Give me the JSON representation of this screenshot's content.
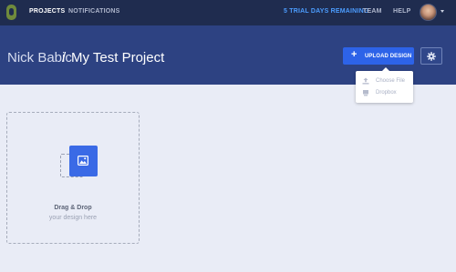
{
  "nav": {
    "projects": "PROJECTS",
    "notifications": "NOTIFICATIONS",
    "trial": "5 TRIAL DAYS REMAINING",
    "team": "TEAM",
    "help": "HELP"
  },
  "icons": {
    "logo": "app-logo",
    "avatar": "user-avatar",
    "caret": "chevron-down-icon",
    "upload_plus": "plus-icon",
    "settings": "gear-icon",
    "choose_file": "upload-icon",
    "dropbox": "dropbox-icon",
    "drop_tile": "image-icon"
  },
  "header": {
    "owner": "Nick Babic",
    "separator": "/",
    "project": "My Test Project"
  },
  "toolbar": {
    "upload_label": "UPLOAD DESIGN",
    "upload_plus": "+"
  },
  "upload_menu": {
    "items": [
      {
        "label": "Choose File"
      },
      {
        "label": "Dropbox"
      }
    ]
  },
  "dropzone": {
    "title": "Drag & Drop",
    "subtitle": "your design here"
  },
  "colors": {
    "topbar": "#1f2c4f",
    "header": "#2d4282",
    "accent": "#2d63e8",
    "trial": "#4c9dff",
    "background": "#e9ecf6"
  }
}
